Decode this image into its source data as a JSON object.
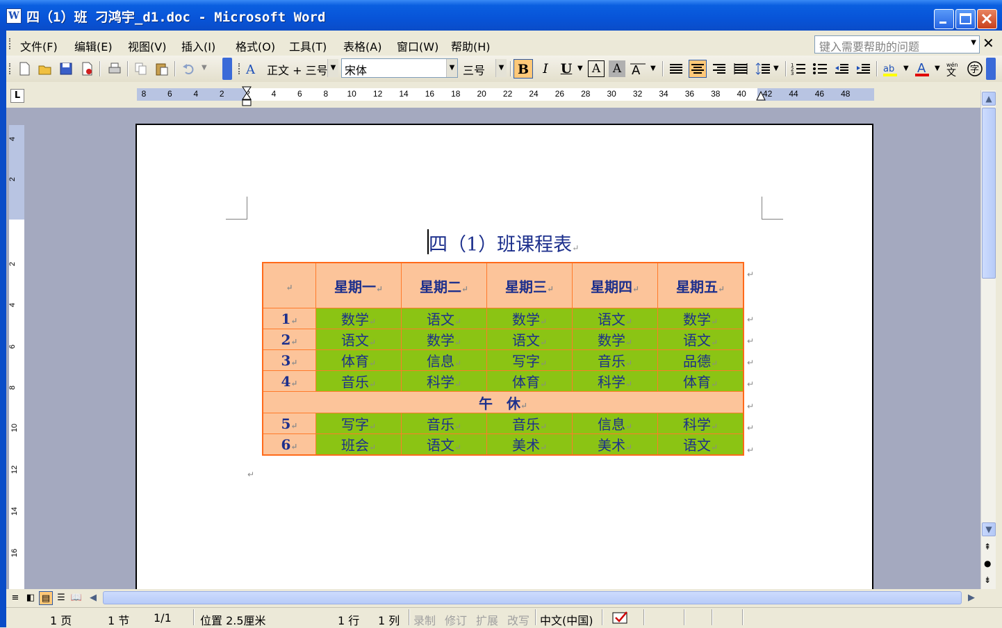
{
  "window": {
    "title": "四（1）班  刁鸿宇_d1.doc - Microsoft Word",
    "app_icon": "W"
  },
  "menu": {
    "items": [
      "文件(F)",
      "编辑(E)",
      "视图(V)",
      "插入(I)",
      "格式(O)",
      "工具(T)",
      "表格(A)",
      "窗口(W)",
      "帮助(H)"
    ],
    "help_placeholder": "键入需要帮助的问题"
  },
  "toolbar": {
    "style": "正文 + 三号",
    "font": "宋体",
    "size": "三号",
    "bold": "B",
    "italic": "I",
    "underline": "U",
    "char_border": "A",
    "char_shading": "A",
    "font_color": "A"
  },
  "ruler": {
    "h_ticks": [
      "8",
      "6",
      "4",
      "2",
      "2",
      "4",
      "6",
      "8",
      "10",
      "12",
      "14",
      "16",
      "18",
      "20",
      "22",
      "24",
      "26",
      "28",
      "30",
      "32",
      "34",
      "36",
      "38",
      "40",
      "42",
      "44",
      "46",
      "48"
    ],
    "v_ticks": [
      "4",
      "2",
      "2",
      "4",
      "6",
      "8",
      "10",
      "12",
      "14",
      "16"
    ]
  },
  "document": {
    "title": "四（1）班课程表",
    "table": {
      "header": [
        "",
        "星期一",
        "星期二",
        "星期三",
        "星期四",
        "星期五"
      ],
      "rows_am": [
        {
          "num": "1",
          "cells": [
            "数学",
            "语文",
            "数学",
            "语文",
            "数学"
          ]
        },
        {
          "num": "2",
          "cells": [
            "语文",
            "数学",
            "语文",
            "数学",
            "语文"
          ]
        },
        {
          "num": "3",
          "cells": [
            "体育",
            "信息",
            "写字",
            "音乐",
            "品德"
          ]
        },
        {
          "num": "4",
          "cells": [
            "音乐",
            "科学",
            "体育",
            "科学",
            "体育"
          ]
        }
      ],
      "lunch": "午　休",
      "rows_pm": [
        {
          "num": "5",
          "cells": [
            "写字",
            "音乐",
            "音乐",
            "信息",
            "科学"
          ]
        },
        {
          "num": "6",
          "cells": [
            "班会",
            "语文",
            "美术",
            "美术",
            "语文"
          ]
        }
      ]
    },
    "para_mark": "↵"
  },
  "status": {
    "page": "1 页",
    "section": "1 节",
    "pages": "1/1",
    "position": "位置 2.5厘米",
    "line": "1 行",
    "column": "1 列",
    "rec": "录制",
    "trk": "修订",
    "ext": "扩展",
    "ovr": "改写",
    "language": "中文(中国)"
  },
  "colors": {
    "title_bar": "#0a5fe0",
    "table_border": "#ff6a1a",
    "header_fill": "#fcc49a",
    "cell_fill": "#8bc414",
    "text_blue": "#1c2f8c"
  }
}
